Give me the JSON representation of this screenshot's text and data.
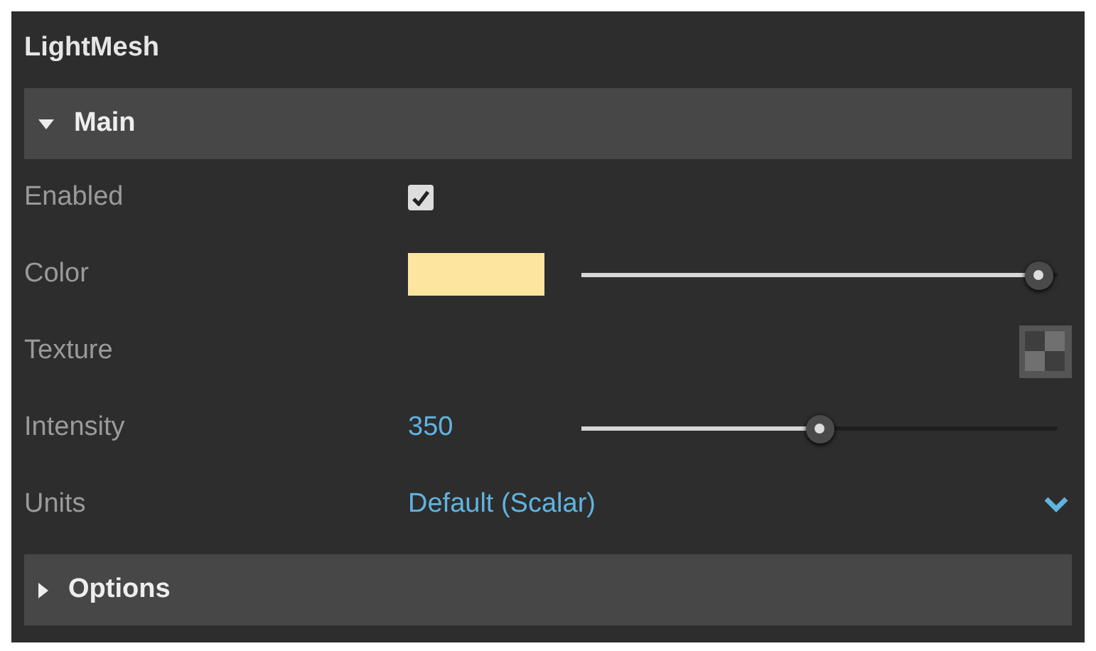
{
  "panel": {
    "title": "LightMesh"
  },
  "sections": [
    {
      "label": "Main",
      "expanded": true,
      "properties": [
        {
          "kind": "checkbox",
          "label": "Enabled",
          "checked": true
        },
        {
          "kind": "color",
          "label": "Color",
          "color": "#fde5a0",
          "level": 0.96
        },
        {
          "kind": "texture",
          "label": "Texture"
        },
        {
          "kind": "number",
          "label": "Intensity",
          "value": "350",
          "level": 0.5
        },
        {
          "kind": "dropdown",
          "label": "Units",
          "value": "Default (Scalar)"
        }
      ]
    },
    {
      "label": "Options",
      "expanded": false
    }
  ]
}
